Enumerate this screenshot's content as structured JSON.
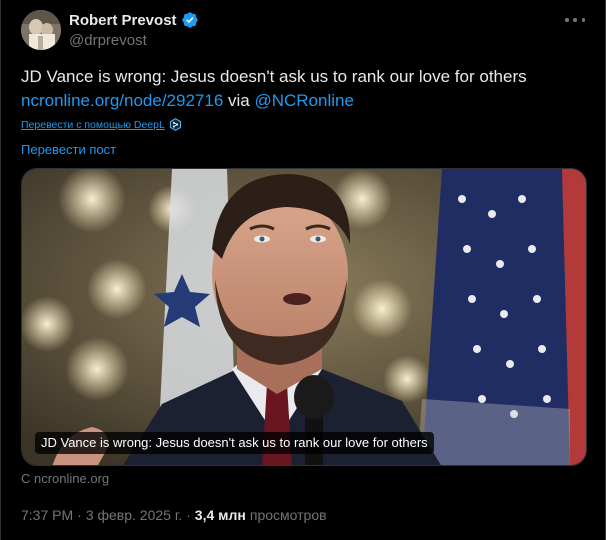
{
  "author": {
    "display_name": "Robert Prevost",
    "handle": "@drprevost",
    "verified": true
  },
  "post": {
    "text_main": "JD Vance is wrong: Jesus doesn't ask us to rank our love for others",
    "link_text": "ncronline.org/node/292716",
    "via_text": " via ",
    "mention_text": "@NCRonline"
  },
  "translation": {
    "translated_by_label": "Перевести с помощью DeepL",
    "translate_post_label": "Перевести пост"
  },
  "card": {
    "caption": "JD Vance is wrong: Jesus doesn't ask us to rank our love for others",
    "source": "С ncronline.org"
  },
  "meta": {
    "time": "7:37 PM",
    "separator": "·",
    "date": "3 февр. 2025 г.",
    "views_count": "3,4 млн",
    "views_label": "просмотров"
  },
  "colors": {
    "background": "#000000",
    "text_primary": "#e7e9ea",
    "text_secondary": "#71767b",
    "link": "#1d9bf0",
    "verified": "#1d9bf0"
  },
  "icons": {
    "verified": "verified-badge-icon",
    "more": "more-dots-icon",
    "deepl": "deepl-icon"
  }
}
